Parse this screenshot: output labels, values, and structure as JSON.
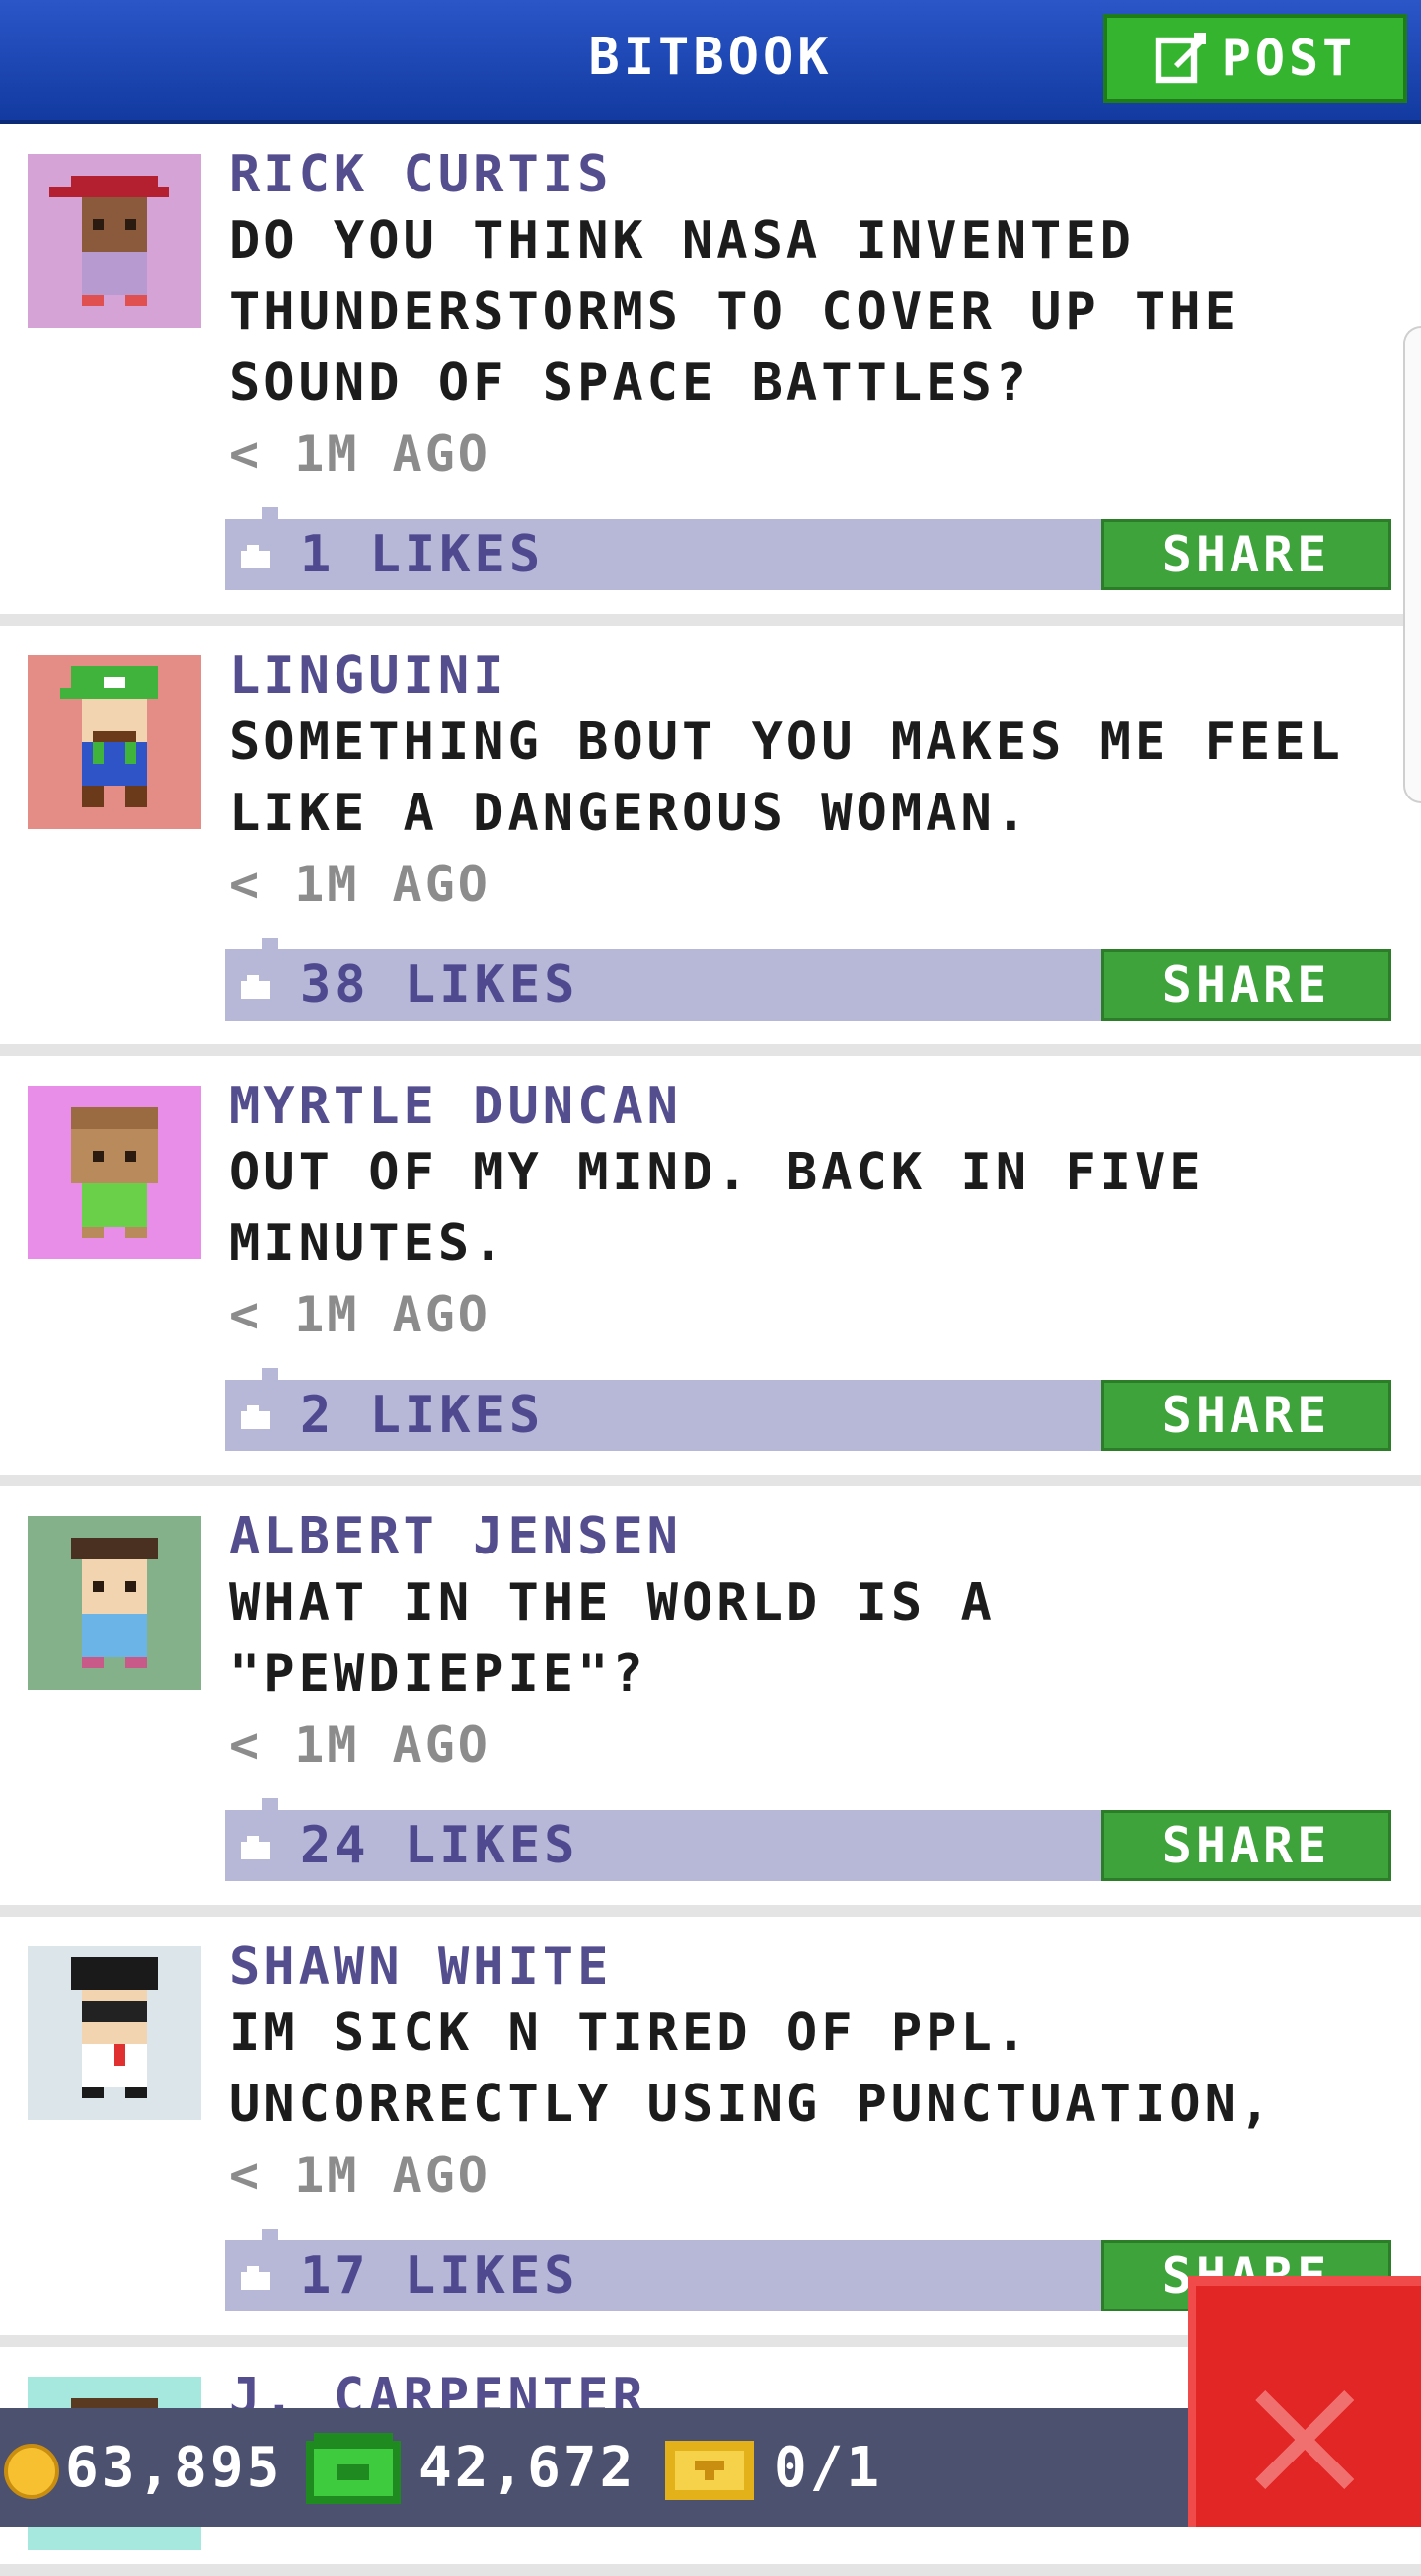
{
  "header": {
    "title": "BITBOOK",
    "post_label": "POST"
  },
  "feed": {
    "share_label": "SHARE",
    "posts": [
      {
        "author": "RICK CURTIS",
        "message": "DO YOU THINK NASA INVENTED THUNDERSTORMS TO COVER UP THE SOUND OF SPACE BATTLES?",
        "time": "< 1M AGO",
        "likes": "1 LIKES",
        "avatar_bg": "#d6a3d6"
      },
      {
        "author": "LINGUINI",
        "message": "SOMETHING BOUT YOU MAKES ME FEEL LIKE A DANGEROUS WOMAN.",
        "time": "< 1M AGO",
        "likes": "38 LIKES",
        "avatar_bg": "#e48c86"
      },
      {
        "author": "MYRTLE DUNCAN",
        "message": "OUT OF MY MIND. BACK IN FIVE MINUTES.",
        "time": "< 1M AGO",
        "likes": "2 LIKES",
        "avatar_bg": "#e88ee8"
      },
      {
        "author": "ALBERT JENSEN",
        "message": "WHAT IN THE WORLD IS A \"PEWDIEPIE\"?",
        "time": "< 1M AGO",
        "likes": "24 LIKES",
        "avatar_bg": "#84b08a"
      },
      {
        "author": "SHAWN WHITE",
        "message": "IM SICK N TIRED OF PPL. UNCORRECTLY USING PUNCTUATION,",
        "time": "< 1M AGO",
        "likes": "17 LIKES",
        "avatar_bg": "#dce6ea"
      },
      {
        "author": "J. CARPENTER",
        "avatar_bg": "#a6e8de"
      }
    ]
  },
  "status_bar": {
    "coins": "63,895",
    "cash": "42,672",
    "tickets": "0/1"
  },
  "colors": {
    "header": "#1f4bbd",
    "accent_green": "#3ea33a",
    "likes_bar": "#b7b8d8",
    "close_red": "#e22626"
  }
}
